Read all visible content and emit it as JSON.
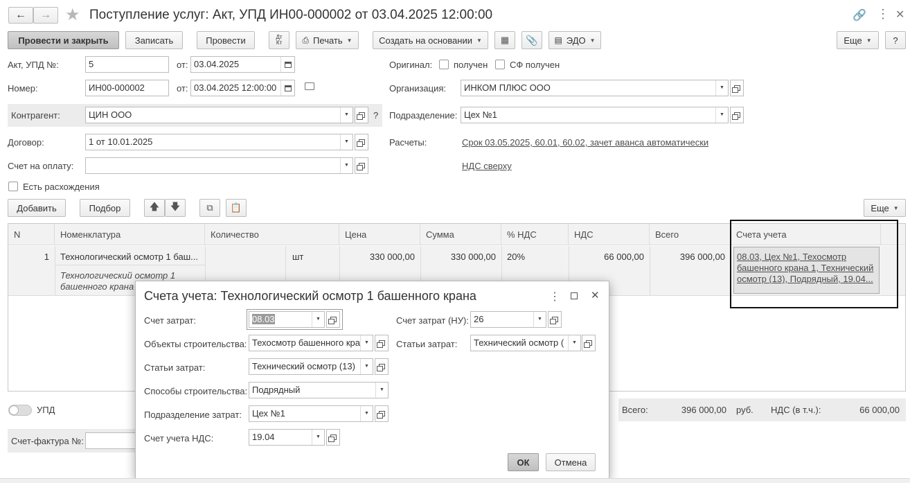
{
  "window": {
    "title": "Поступление услуг: Акт, УПД ИН00-000002 от 03.04.2025 12:00:00"
  },
  "toolbar": {
    "post_close": "Провести и закрыть",
    "save": "Записать",
    "post": "Провести",
    "dtkt": "Дт Кт",
    "print": "Печать",
    "create_based": "Создать на основании",
    "edo": "ЭДО",
    "more": "Еще",
    "help": "?"
  },
  "form": {
    "act_label": "Акт, УПД №:",
    "act_value": "5",
    "from_label": "от:",
    "act_date": "03.04.2025",
    "number_label": "Номер:",
    "number_value": "ИН00-000002",
    "number_date": "03.04.2025 12:00:00",
    "original_label": "Оригинал:",
    "received_label": "получен",
    "sf_received_label": "СФ получен",
    "org_label": "Организация:",
    "org_value": "ИНКОМ ПЛЮС ООО",
    "counterparty_label": "Контрагент:",
    "counterparty_value": "ЦИН ООО",
    "question": "?",
    "division_label": "Подразделение:",
    "division_value": "Цех №1",
    "contract_label": "Договор:",
    "contract_value": "1 от 10.01.2025",
    "settlements_label": "Расчеты:",
    "settlements_link": "Срок 03.05.2025, 60.01, 60.02, зачет аванса автоматически",
    "invoice_label": "Счет на оплату:",
    "invoice_value": "",
    "vat_link": "НДС сверху",
    "discrepancies_label": "Есть расхождения"
  },
  "table_toolbar": {
    "add": "Добавить",
    "pick": "Подбор",
    "more": "Еще"
  },
  "table": {
    "headers": [
      "N",
      "Номенклатура",
      "Количество",
      "Цена",
      "Сумма",
      "% НДС",
      "НДС",
      "Всего",
      "Счета учета"
    ],
    "rows": [
      {
        "n": "1",
        "item": "Технологический осмотр 1 баш...",
        "item_desc": "Технологический осмотр 1 башенного крана",
        "qty": "",
        "unit": "шт",
        "price": "330 000,00",
        "sum": "330 000,00",
        "vat_rate": "20%",
        "vat": "66 000,00",
        "total": "396 000,00",
        "accounts": "08.03, Цех №1, Техосмотр башенного крана 1, Технический осмотр (13), Подрядный, 19.04..."
      }
    ]
  },
  "footer": {
    "upd_label": "УПД",
    "total_label": "Всего:",
    "total_value": "396 000,00",
    "currency": "руб.",
    "vat_label": "НДС (в т.ч.):",
    "vat_value": "66 000,00",
    "invoice_label": "Счет-фактура №:"
  },
  "dialog": {
    "title": "Счета учета: Технологический осмотр 1 башенного крана",
    "cost_account_label": "Счет затрат:",
    "cost_account_value": "08.03",
    "cost_account_nu_label": "Счет затрат (НУ):",
    "cost_account_nu_value": "26",
    "objects_label": "Объекты строительства:",
    "objects_value": "Техосмотр башенного кра",
    "cost_items_nu_label": "Статьи затрат:",
    "cost_items_nu_value": "Технический осмотр (",
    "cost_items_label": "Статьи затрат:",
    "cost_items_value": "Технический осмотр (13)",
    "methods_label": "Способы строительства:",
    "methods_value": "Подрядный",
    "cost_division_label": "Подразделение затрат:",
    "cost_division_value": "Цех №1",
    "vat_account_label": "Счет учета НДС:",
    "vat_account_value": "19.04",
    "ok": "ОК",
    "cancel": "Отмена"
  }
}
